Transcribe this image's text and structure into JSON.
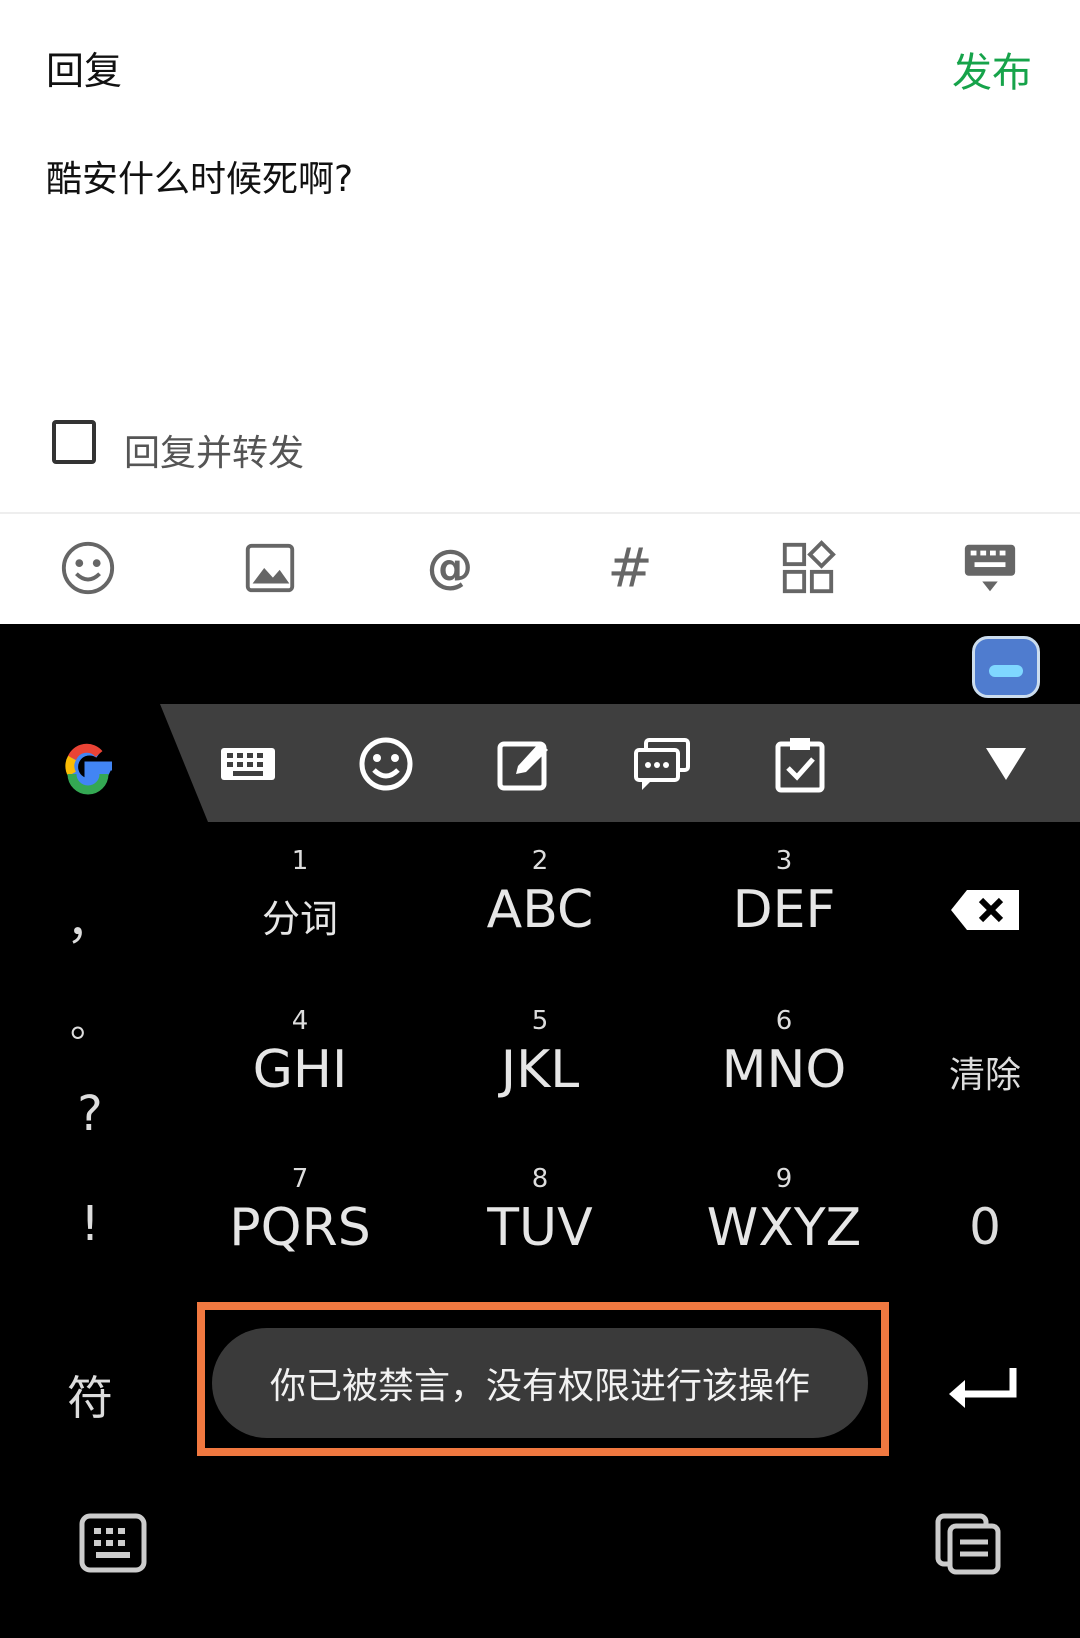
{
  "header": {
    "title": "回复",
    "publish_label": "发布"
  },
  "editor": {
    "content": "酷安什么时候死啊?"
  },
  "repost_option": {
    "label": "回复并转发",
    "checked": false
  },
  "toolbar": {
    "icons": [
      "emoji-icon",
      "image-icon",
      "at-icon",
      "hashtag-icon",
      "apps-icon",
      "keyboard-hide-icon"
    ]
  },
  "ime": {
    "bar_icons": [
      "google-icon",
      "keyboard-icon",
      "emoji-icon",
      "edit-icon",
      "chat-icon",
      "clipboard-icon",
      "collapse-icon"
    ],
    "left_column": [
      "，",
      "。",
      "?",
      "!",
      "符"
    ],
    "keys": [
      {
        "num": "1",
        "label": "分词"
      },
      {
        "num": "2",
        "label": "ABC"
      },
      {
        "num": "3",
        "label": "DEF"
      },
      {
        "num": "4",
        "label": "GHI"
      },
      {
        "num": "5",
        "label": "JKL"
      },
      {
        "num": "6",
        "label": "MNO"
      },
      {
        "num": "7",
        "label": "PQRS"
      },
      {
        "num": "8",
        "label": "TUV"
      },
      {
        "num": "9",
        "label": "WXYZ"
      }
    ],
    "right_column": {
      "clear": "清除",
      "zero": "0"
    }
  },
  "toast": {
    "message": "你已被禁言，没有权限进行该操作",
    "highlight_color": "#f07840"
  },
  "colors": {
    "accent": "#16a34a",
    "keyboard_bg": "#000000",
    "bar_bg": "#3f3f3f"
  }
}
